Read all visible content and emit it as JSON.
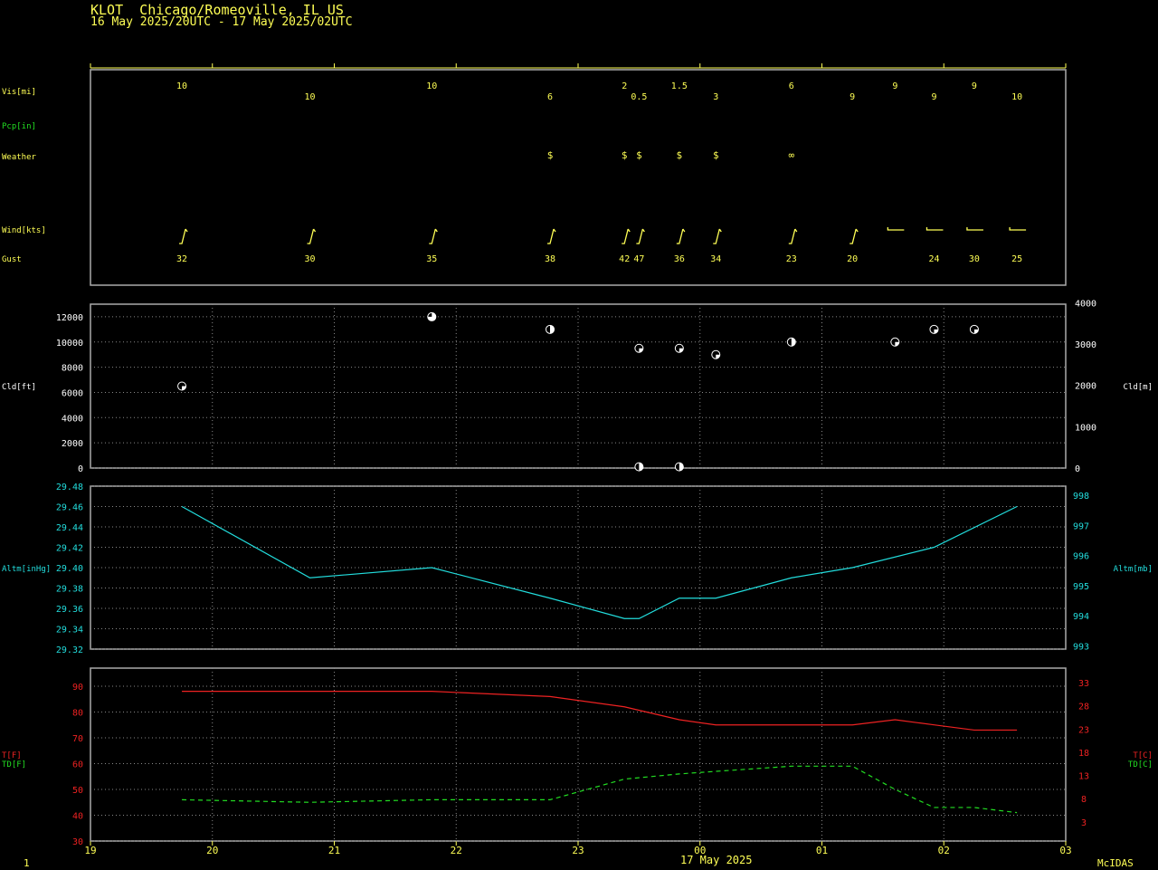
{
  "header": {
    "station": "KLOT  Chicago/Romeoville, IL US",
    "period": "16 May 2025/20UTC - 17 May 2025/02UTC"
  },
  "footer": {
    "date": "17 May 2025",
    "software": "McIDAS",
    "frame": "1"
  },
  "colors": {
    "yellow": "#ffff55",
    "green": "#22dd22",
    "cyan": "#22dddd",
    "red": "#ee2222",
    "white": "#ffffff",
    "frame": "#aaaaaa"
  },
  "chart_data": [
    {
      "type": "table",
      "panel": "surface-obs",
      "rows": [
        {
          "label": "Vis[mi]",
          "color": "yellow"
        },
        {
          "label": "Pcp[in]",
          "color": "green"
        },
        {
          "label": "Weather",
          "color": "yellow"
        },
        {
          "label": "Wind[kts]",
          "color": "yellow"
        },
        {
          "label": "Gust",
          "color": "yellow"
        }
      ],
      "obs": [
        {
          "t": 19.75,
          "vis": "10",
          "vis_high": true,
          "wx": "",
          "wind": "barb",
          "gust": "32"
        },
        {
          "t": 20.8,
          "vis": "10",
          "vis_high": false,
          "wx": "",
          "wind": "barb",
          "gust": "30"
        },
        {
          "t": 21.8,
          "vis": "10",
          "vis_high": true,
          "wx": "",
          "wind": "barb",
          "gust": "35"
        },
        {
          "t": 22.77,
          "vis": "6",
          "vis_high": false,
          "wx": "$",
          "wind": "barb",
          "gust": "38"
        },
        {
          "t": 23.38,
          "vis": "2",
          "vis_high": true,
          "wx": "$",
          "wind": "barb",
          "gust": "42"
        },
        {
          "t": 23.5,
          "vis": "0.5",
          "vis_high": false,
          "wx": "$",
          "wind": "barb",
          "gust": "47"
        },
        {
          "t": 23.83,
          "vis": "1.5",
          "vis_high": true,
          "wx": "$",
          "wind": "barb",
          "gust": "36"
        },
        {
          "t": 24.13,
          "vis": "3",
          "vis_high": false,
          "wx": "$",
          "wind": "barb",
          "gust": "34"
        },
        {
          "t": 24.75,
          "vis": "6",
          "vis_high": true,
          "wx": "∞",
          "wind": "barb",
          "gust": "23"
        },
        {
          "t": 25.25,
          "vis": "9",
          "vis_high": false,
          "wx": "",
          "wind": "barb",
          "gust": "20"
        },
        {
          "t": 25.6,
          "vis": "9",
          "vis_high": true,
          "wx": "",
          "wind": "flat",
          "gust": ""
        },
        {
          "t": 25.92,
          "vis": "9",
          "vis_high": false,
          "wx": "",
          "wind": "flat",
          "gust": "24"
        },
        {
          "t": 26.25,
          "vis": "9",
          "vis_high": true,
          "wx": "",
          "wind": "flat",
          "gust": "30"
        },
        {
          "t": 26.6,
          "vis": "10",
          "vis_high": false,
          "wx": "",
          "wind": "flat",
          "gust": "25"
        }
      ]
    },
    {
      "type": "scatter",
      "panel": "cloud",
      "ylabel_left": "Cld[ft]",
      "ylabel_right": "Cld[m]",
      "ylim": [
        0,
        13000
      ],
      "yticks_left": [
        0,
        2000,
        4000,
        6000,
        8000,
        10000,
        12000
      ],
      "yticks_right": [
        0,
        1000,
        2000,
        3000,
        4000
      ],
      "points": [
        {
          "t": 19.75,
          "y": 6500,
          "cover": "scattered"
        },
        {
          "t": 21.8,
          "y": 12000,
          "cover": "broken"
        },
        {
          "t": 22.77,
          "y": 11000,
          "cover": "half"
        },
        {
          "t": 23.5,
          "y": 9500,
          "cover": "scattered"
        },
        {
          "t": 23.5,
          "y": 100,
          "cover": "half"
        },
        {
          "t": 23.83,
          "y": 9500,
          "cover": "scattered"
        },
        {
          "t": 23.83,
          "y": 100,
          "cover": "half"
        },
        {
          "t": 24.13,
          "y": 9000,
          "cover": "scattered"
        },
        {
          "t": 24.75,
          "y": 10000,
          "cover": "half"
        },
        {
          "t": 25.6,
          "y": 10000,
          "cover": "scattered"
        },
        {
          "t": 25.92,
          "y": 11000,
          "cover": "scattered"
        },
        {
          "t": 26.25,
          "y": 11000,
          "cover": "scattered"
        }
      ]
    },
    {
      "type": "line",
      "panel": "altimeter",
      "ylabel_left": "Altm[inHg]",
      "ylabel_right": "Altm[mb]",
      "ylim": [
        29.32,
        29.48
      ],
      "yticks_left": [
        "29.32",
        "29.34",
        "29.36",
        "29.38",
        "29.40",
        "29.42",
        "29.44",
        "29.46",
        "29.48"
      ],
      "yticks_right": [
        993,
        994,
        995,
        996,
        997,
        998
      ],
      "x": [
        19.75,
        20.8,
        21.8,
        22.77,
        23.38,
        23.5,
        23.83,
        24.13,
        24.75,
        25.25,
        25.92,
        26.6
      ],
      "values": [
        29.46,
        29.39,
        29.4,
        29.37,
        29.35,
        29.35,
        29.37,
        29.37,
        29.39,
        29.4,
        29.42,
        29.46
      ]
    },
    {
      "type": "line",
      "panel": "temperature",
      "ylabel_left_t": "T[F]",
      "ylabel_left_td": "TD[F]",
      "ylabel_right_t": "T[C]",
      "ylabel_right_td": "TD[C]",
      "ylim": [
        30,
        97
      ],
      "yticks_left": [
        30,
        40,
        50,
        60,
        70,
        80,
        90
      ],
      "yticks_right": [
        3,
        8,
        13,
        18,
        23,
        28,
        33
      ],
      "series": [
        {
          "name": "T[F]",
          "color": "red",
          "dash": false,
          "x": [
            19.75,
            20.8,
            21.8,
            22.77,
            23.38,
            23.83,
            24.13,
            24.75,
            25.25,
            25.6,
            25.92,
            26.25,
            26.6
          ],
          "values": [
            88,
            88,
            88,
            86,
            82,
            77,
            75,
            75,
            75,
            77,
            75,
            73,
            73
          ]
        },
        {
          "name": "TD[F]",
          "color": "green",
          "dash": true,
          "x": [
            19.75,
            20.8,
            21.8,
            22.77,
            23.38,
            23.83,
            24.13,
            24.75,
            25.25,
            25.6,
            25.92,
            26.25,
            26.6
          ],
          "values": [
            46,
            45,
            46,
            46,
            54,
            56,
            57,
            59,
            59,
            50,
            43,
            43,
            41
          ]
        }
      ]
    },
    {
      "type": "axis",
      "panel": "time-axis",
      "xlim": [
        19,
        27
      ],
      "xticks": [
        19,
        20,
        21,
        22,
        23,
        24,
        25,
        26,
        27
      ],
      "xtick_labels": [
        "19",
        "20",
        "21",
        "22",
        "23",
        "00",
        "01",
        "02",
        "03"
      ]
    }
  ]
}
